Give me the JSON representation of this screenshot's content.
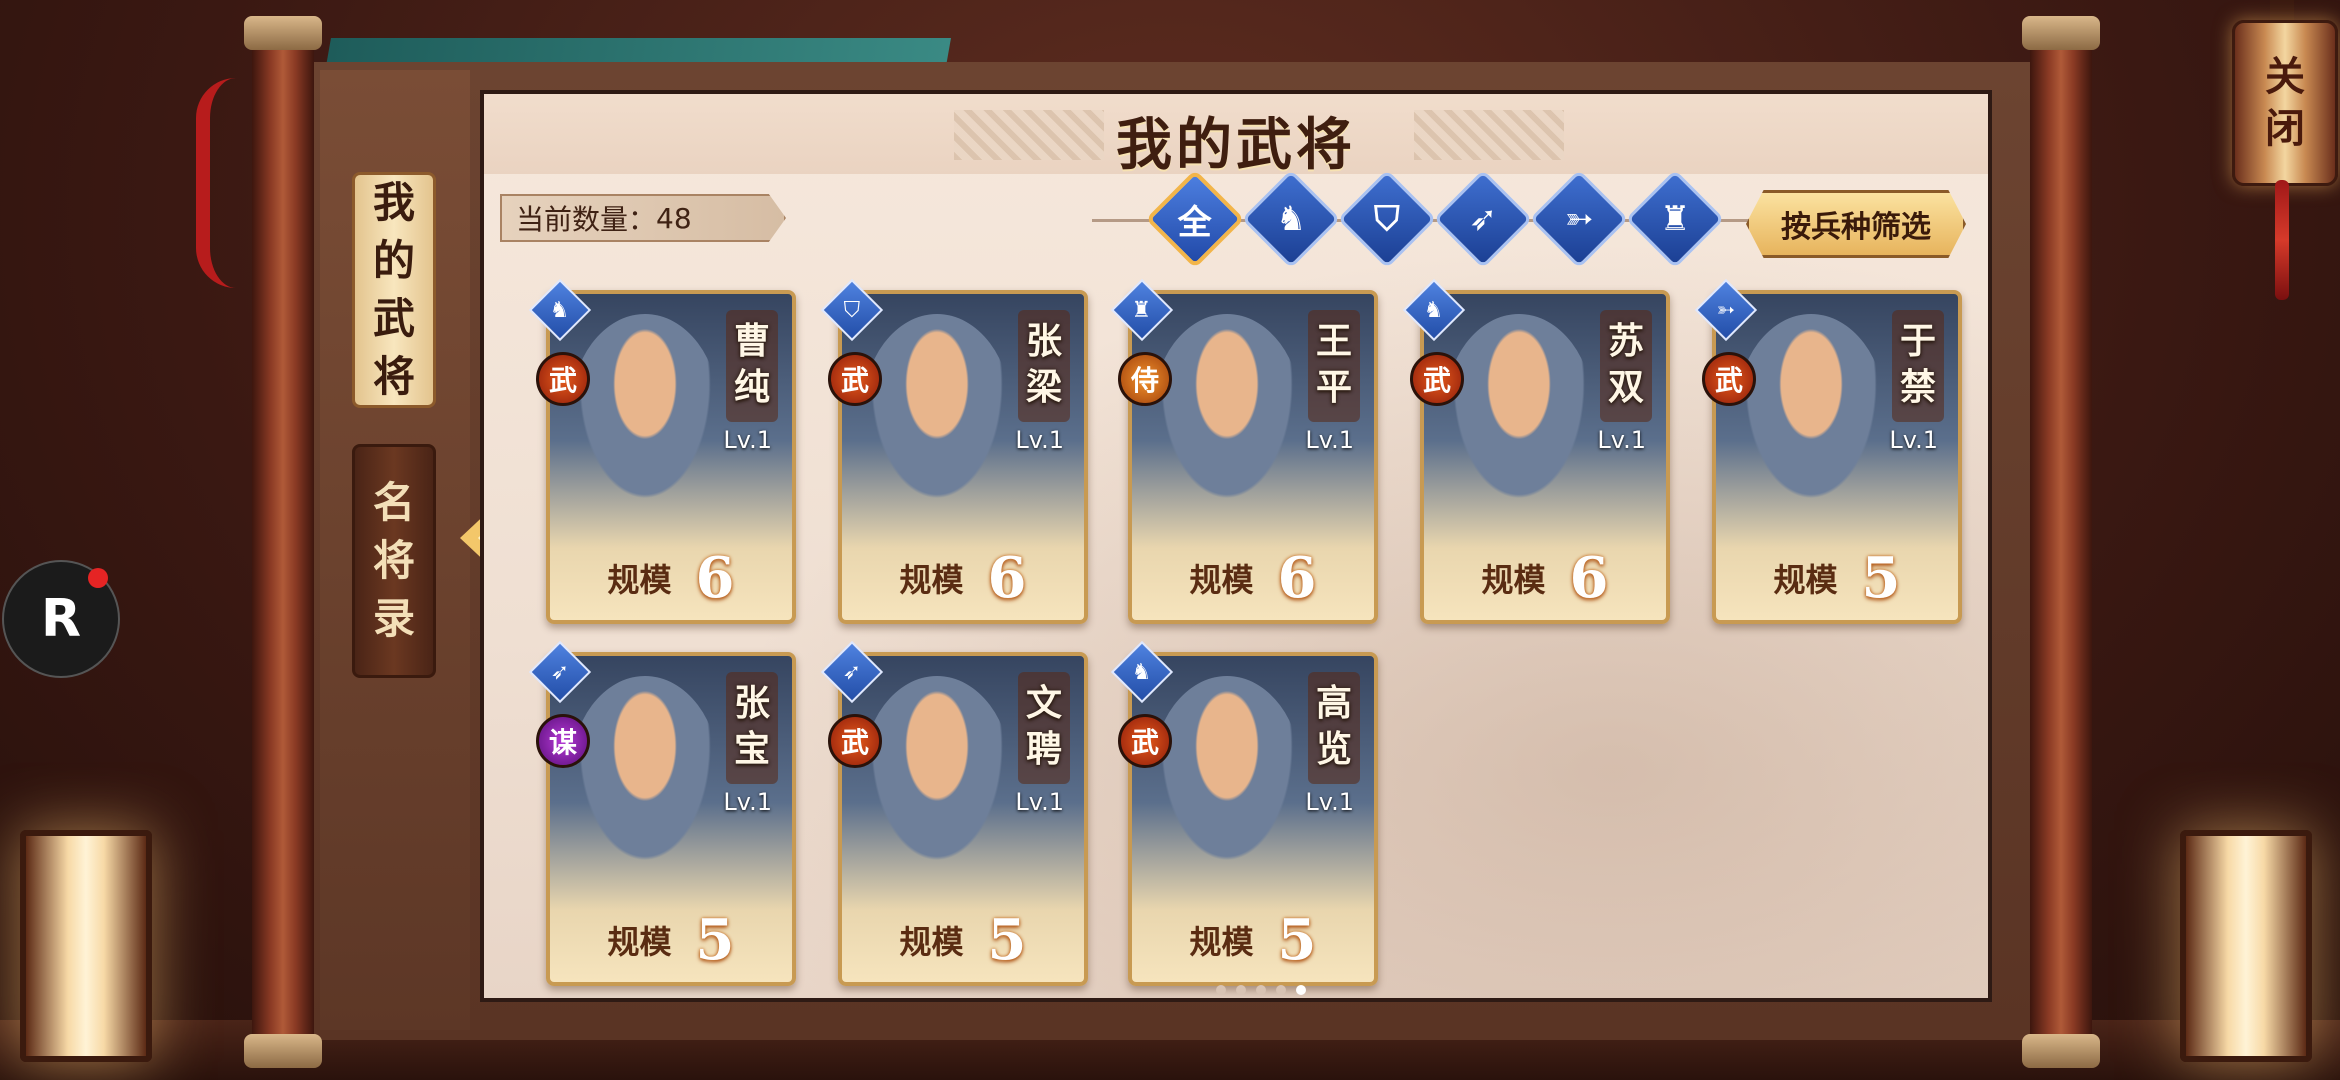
{
  "close_button": {
    "label_top": "关",
    "label_bottom": "闭"
  },
  "side_tabs": [
    {
      "label": "我的武将",
      "active": true
    },
    {
      "label": "名将录",
      "active": false
    }
  ],
  "title": "我的武将",
  "count": {
    "label": "当前数量：",
    "value": "48"
  },
  "filters": [
    {
      "label": "全",
      "icon": "all",
      "active": true
    },
    {
      "label": "",
      "icon": "cavalry-icon",
      "active": false
    },
    {
      "label": "",
      "icon": "shield-icon",
      "active": false
    },
    {
      "label": "",
      "icon": "spear-icon",
      "active": false
    },
    {
      "label": "",
      "icon": "bow-icon",
      "active": false
    },
    {
      "label": "",
      "icon": "siege-icon",
      "active": false
    }
  ],
  "filter_select_label": "按兵种筛选",
  "scale_label": "规模",
  "generals": [
    {
      "name_1": "曹",
      "name_2": "纯",
      "level": "Lv.1",
      "scale": "6",
      "role": "武",
      "role_type": "wu",
      "troop_icon": "cavalry-icon"
    },
    {
      "name_1": "张",
      "name_2": "梁",
      "level": "Lv.1",
      "scale": "6",
      "role": "武",
      "role_type": "wu",
      "troop_icon": "shield-icon"
    },
    {
      "name_1": "王",
      "name_2": "平",
      "level": "Lv.1",
      "scale": "6",
      "role": "侍",
      "role_type": "shi",
      "troop_icon": "siege-icon"
    },
    {
      "name_1": "苏",
      "name_2": "双",
      "level": "Lv.1",
      "scale": "6",
      "role": "武",
      "role_type": "wu",
      "troop_icon": "cavalry-icon"
    },
    {
      "name_1": "于",
      "name_2": "禁",
      "level": "Lv.1",
      "scale": "5",
      "role": "武",
      "role_type": "wu",
      "troop_icon": "bow-icon"
    },
    {
      "name_1": "张",
      "name_2": "宝",
      "level": "Lv.1",
      "scale": "5",
      "role": "谋",
      "role_type": "mou",
      "troop_icon": "spear-icon"
    },
    {
      "name_1": "文",
      "name_2": "聘",
      "level": "Lv.1",
      "scale": "5",
      "role": "武",
      "role_type": "wu",
      "troop_icon": "spear-icon"
    },
    {
      "name_1": "高",
      "name_2": "览",
      "level": "Lv.1",
      "scale": "5",
      "role": "武",
      "role_type": "wu",
      "troop_icon": "cavalry-icon"
    }
  ],
  "pager": {
    "pages": 5,
    "current": 5
  },
  "colors": {
    "accent_gold": "#f2b54a",
    "troop_blue": "#2149a8",
    "role_wu": "#8e1c0a",
    "role_mou": "#5a0f7a"
  }
}
